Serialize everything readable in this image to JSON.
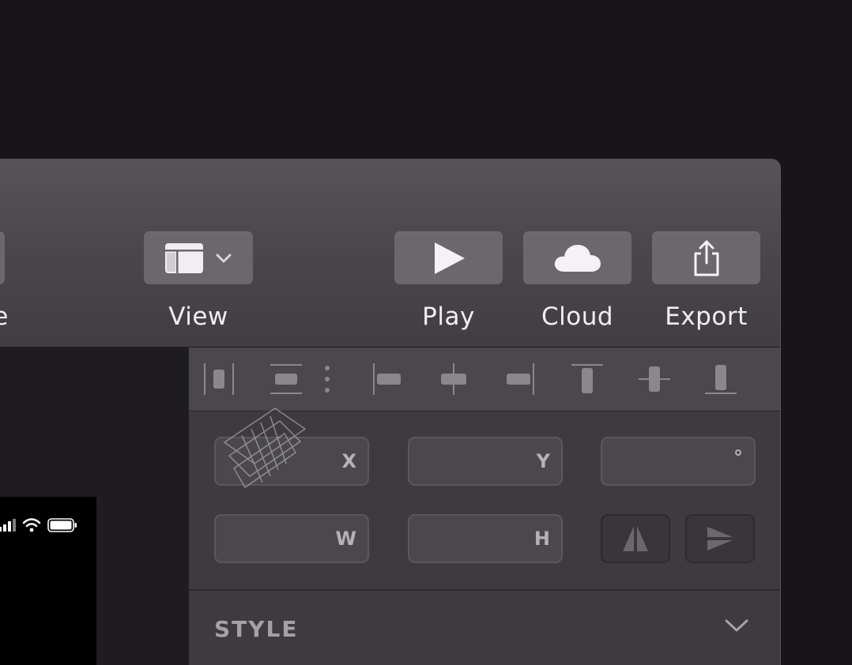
{
  "toolbar": {
    "view_label": "View",
    "play_label": "Play",
    "cloud_label": "Cloud",
    "export_label": "Export",
    "partial_label": "e"
  },
  "inspector": {
    "fields": {
      "x_label": "X",
      "y_label": "Y",
      "rotation_label": "°",
      "w_label": "W",
      "h_label": "H"
    },
    "style_section": "STYLE"
  },
  "colors": {
    "accent_text": "#f0eef1",
    "button_bg": "#6a686b",
    "inspector_bg": "#3d3b3e"
  }
}
